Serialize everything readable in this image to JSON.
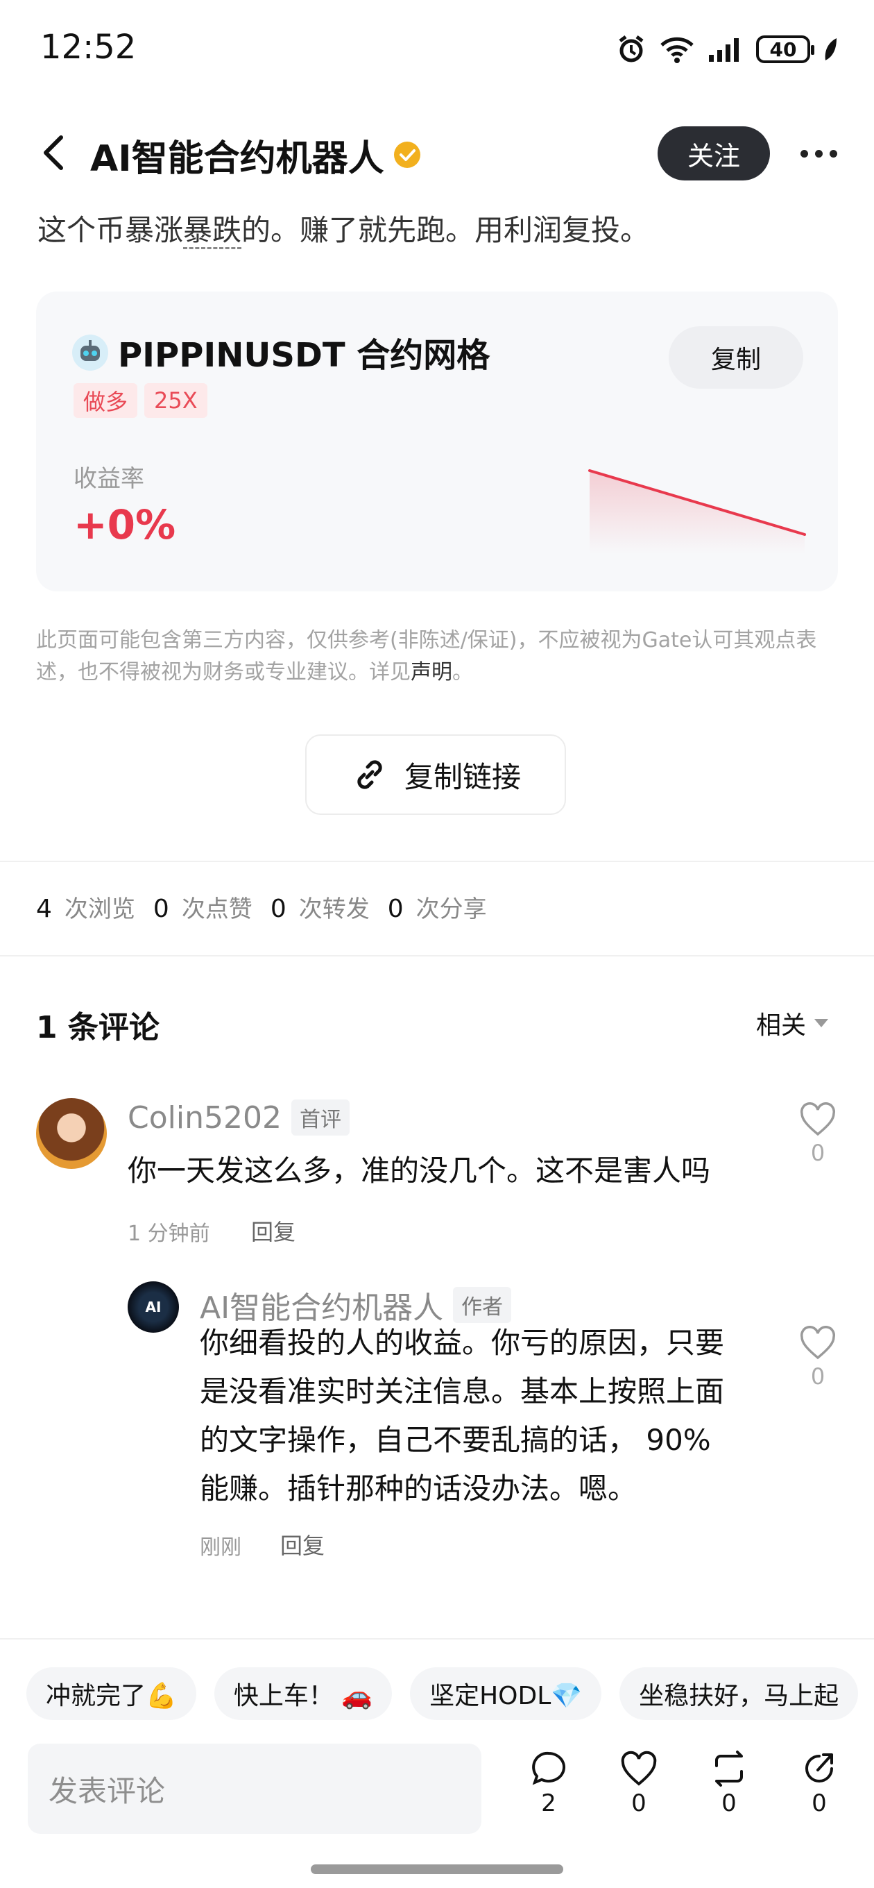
{
  "status_bar": {
    "time": "12:52",
    "battery": "40"
  },
  "header": {
    "title": "AI智能合约机器人",
    "follow_label": "关注"
  },
  "post": {
    "text_pre": "这个币暴涨",
    "text_underlined": "暴跌",
    "text_post": "的。赚了就先跑。用利润复投。"
  },
  "card": {
    "title": "PIPPINUSDT 合约网格",
    "copy_label": "复制",
    "tags": [
      "做多",
      "25X"
    ],
    "rate_label": "收益率",
    "rate_value": "+0%",
    "accent": "#e8394d"
  },
  "disclaimer": {
    "text": "此页面可能包含第三方内容，仅供参考(非陈述/保证)，不应被视为Gate认可其观点表述，也不得被视为财务或专业建议。详见",
    "link": "声明",
    "end": "。"
  },
  "copy_link_label": "复制链接",
  "stats": [
    {
      "num": "4",
      "label": "次浏览"
    },
    {
      "num": "0",
      "label": "次点赞"
    },
    {
      "num": "0",
      "label": "次转发"
    },
    {
      "num": "0",
      "label": "次分享"
    }
  ],
  "comments_header": {
    "count_label": "1 条评论",
    "sort_label": "相关"
  },
  "comments": [
    {
      "user": "Colin5202",
      "badge": "首评",
      "text": "你一天发这么多，准的没几个。这不是害人吗",
      "time": "1 分钟前",
      "reply_label": "回复",
      "likes": "0"
    },
    {
      "user": "AI智能合约机器人",
      "badge": "作者",
      "avatar_text": "AI",
      "text_lines": [
        "你细看投的人的收益。你亏的原因，只要",
        "是没看准实时关注信息。基本上按照上面",
        "的文字操作，自己不要乱搞的话， 90%",
        "能赚。插针那种的话没办法。嗯。"
      ],
      "time": "刚刚",
      "reply_label": "回复",
      "likes": "0"
    }
  ],
  "quick_replies": [
    "冲就完了💪",
    "快上车！ 🚗",
    "坚定HODL💎",
    "坐稳扶好，马上起"
  ],
  "bottom_bar": {
    "input_placeholder": "发表评论",
    "actions": [
      {
        "icon": "comment-icon",
        "count": "2"
      },
      {
        "icon": "heart-icon",
        "count": "0"
      },
      {
        "icon": "repost-icon",
        "count": "0"
      },
      {
        "icon": "share-icon",
        "count": "0"
      }
    ]
  }
}
